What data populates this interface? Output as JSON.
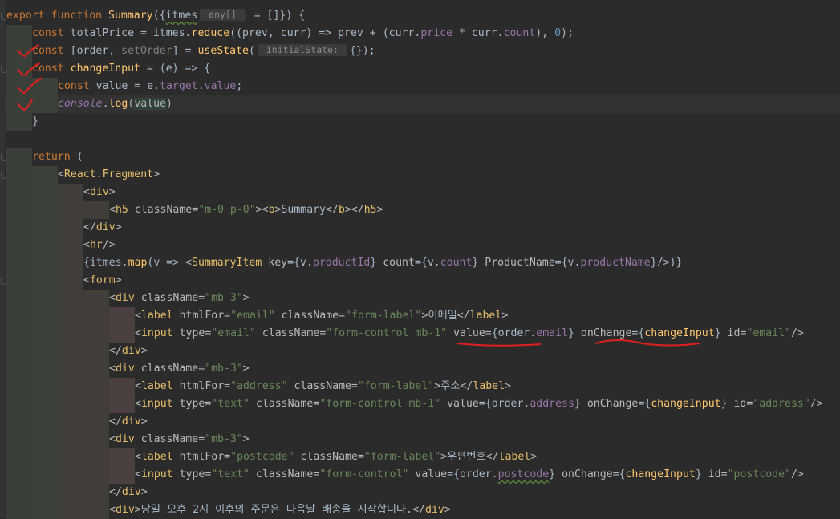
{
  "editor": {
    "lines": [
      [
        [
          "export function ",
          "kw"
        ],
        [
          "Summary",
          "fn"
        ],
        [
          "({",
          ""
        ],
        [
          "itmes",
          "u"
        ],
        [
          " any[] ",
          "hint"
        ],
        [
          " = []}) {",
          ""
        ]
      ],
      [
        [
          "const ",
          "kw"
        ],
        [
          "totalPrice = itmes.",
          ""
        ],
        [
          "reduce",
          "fn"
        ],
        [
          "((prev, curr) => prev + (curr.",
          ""
        ],
        [
          "price",
          "pr"
        ],
        [
          " * curr.",
          ""
        ],
        [
          "count",
          "pr"
        ],
        [
          "), ",
          ""
        ],
        [
          "0",
          "num"
        ],
        [
          ");",
          ""
        ]
      ],
      [
        [
          "const ",
          "kw"
        ],
        [
          "[order, ",
          ""
        ],
        [
          "setOrder",
          "gray"
        ],
        [
          "] = ",
          ""
        ],
        [
          "useState",
          "fn"
        ],
        [
          "(",
          ""
        ],
        [
          " initialState: ",
          "hint"
        ],
        [
          "{});",
          ""
        ]
      ],
      [
        [
          "const ",
          "kw"
        ],
        [
          "changeInput",
          "fn"
        ],
        [
          " = (e) => {",
          ""
        ]
      ],
      [
        [
          "const ",
          "kw"
        ],
        [
          "value = e.",
          ""
        ],
        [
          "target",
          "pr"
        ],
        [
          ".",
          ""
        ],
        [
          "value",
          "pr"
        ],
        [
          ";",
          ""
        ]
      ],
      [
        [
          "console",
          "pr it"
        ],
        [
          ".",
          ""
        ],
        [
          "log",
          "fn"
        ],
        [
          "(",
          ""
        ],
        [
          "value",
          "hl"
        ],
        [
          ")",
          ""
        ]
      ],
      [
        [
          "}",
          ""
        ]
      ],
      [
        [
          "",
          ""
        ]
      ],
      [
        [
          "return ",
          "kw"
        ],
        [
          "(",
          ""
        ]
      ],
      [
        [
          "<",
          "at"
        ],
        [
          "React.Fragment",
          "tg"
        ],
        [
          ">",
          "at"
        ]
      ],
      [
        [
          "<",
          "at"
        ],
        [
          "div",
          "tg"
        ],
        [
          ">",
          "at"
        ]
      ],
      [
        [
          "<",
          "at"
        ],
        [
          "h5 ",
          "tg"
        ],
        [
          "className",
          "at"
        ],
        [
          "=",
          "at"
        ],
        [
          "\"m-0 p-0\"",
          "st"
        ],
        [
          "><",
          "at"
        ],
        [
          "b",
          "tg"
        ],
        [
          ">",
          "at"
        ],
        [
          "Summary",
          ""
        ],
        [
          "</",
          "at"
        ],
        [
          "b",
          "tg"
        ],
        [
          "></",
          "at"
        ],
        [
          "h5",
          "tg"
        ],
        [
          ">",
          "at"
        ]
      ],
      [
        [
          "</",
          "at"
        ],
        [
          "div",
          "tg"
        ],
        [
          ">",
          "at"
        ]
      ],
      [
        [
          "<",
          "at"
        ],
        [
          "hr",
          "tg"
        ],
        [
          "/>",
          "at"
        ]
      ],
      [
        [
          "{itmes.",
          ""
        ],
        [
          "map",
          "fn"
        ],
        [
          "(v => ",
          ""
        ],
        [
          "<",
          "at"
        ],
        [
          "SummaryItem ",
          "tg"
        ],
        [
          "key",
          "at"
        ],
        [
          "={v.",
          ""
        ],
        [
          "productId",
          "pr"
        ],
        [
          "} ",
          ""
        ],
        [
          "count",
          "at"
        ],
        [
          "={v.",
          ""
        ],
        [
          "count",
          "pr"
        ],
        [
          "} ",
          ""
        ],
        [
          "ProductName",
          "at"
        ],
        [
          "={v.",
          ""
        ],
        [
          "productName",
          "pr"
        ],
        [
          "}/>)}",
          ""
        ]
      ],
      [
        [
          "<",
          "at"
        ],
        [
          "form",
          "tg"
        ],
        [
          ">",
          "at"
        ]
      ],
      [
        [
          "<",
          "at"
        ],
        [
          "div ",
          "tg"
        ],
        [
          "className",
          "at"
        ],
        [
          "=",
          "at"
        ],
        [
          "\"mb-3\"",
          "st"
        ],
        [
          ">",
          "at"
        ]
      ],
      [
        [
          "<",
          "at"
        ],
        [
          "label ",
          "tg"
        ],
        [
          "htmlFor",
          "at"
        ],
        [
          "=",
          "at"
        ],
        [
          "\"email\" ",
          "st"
        ],
        [
          "className",
          "at"
        ],
        [
          "=",
          "at"
        ],
        [
          "\"form-label\"",
          "st"
        ],
        [
          ">",
          "at"
        ],
        [
          "이메일",
          ""
        ],
        [
          "</",
          "at"
        ],
        [
          "label",
          "tg"
        ],
        [
          ">",
          "at"
        ]
      ],
      [
        [
          "<",
          "at"
        ],
        [
          "input ",
          "tg"
        ],
        [
          "type",
          "at"
        ],
        [
          "=",
          "at"
        ],
        [
          "\"email\" ",
          "st"
        ],
        [
          "className",
          "at"
        ],
        [
          "=",
          "at"
        ],
        [
          "\"form-control mb-1\" ",
          "st"
        ],
        [
          "value",
          "at"
        ],
        [
          "={order.",
          ""
        ],
        [
          "email",
          "pr"
        ],
        [
          "} ",
          ""
        ],
        [
          "onChange",
          "at"
        ],
        [
          "={",
          ""
        ],
        [
          "changeInput",
          "fn"
        ],
        [
          "} ",
          ""
        ],
        [
          "id",
          "at"
        ],
        [
          "=",
          "at"
        ],
        [
          "\"email\"",
          "st"
        ],
        [
          "/>",
          "at"
        ]
      ],
      [
        [
          "</",
          "at"
        ],
        [
          "div",
          "tg"
        ],
        [
          ">",
          "at"
        ]
      ],
      [
        [
          "<",
          "at"
        ],
        [
          "div ",
          "tg"
        ],
        [
          "className",
          "at"
        ],
        [
          "=",
          "at"
        ],
        [
          "\"mb-3\"",
          "st"
        ],
        [
          ">",
          "at"
        ]
      ],
      [
        [
          "<",
          "at"
        ],
        [
          "label ",
          "tg"
        ],
        [
          "htmlFor",
          "at"
        ],
        [
          "=",
          "at"
        ],
        [
          "\"address\" ",
          "st"
        ],
        [
          "className",
          "at"
        ],
        [
          "=",
          "at"
        ],
        [
          "\"form-label\"",
          "st"
        ],
        [
          ">",
          "at"
        ],
        [
          "주소",
          ""
        ],
        [
          "</",
          "at"
        ],
        [
          "label",
          "tg"
        ],
        [
          ">",
          "at"
        ]
      ],
      [
        [
          "<",
          "at"
        ],
        [
          "input ",
          "tg"
        ],
        [
          "type",
          "at"
        ],
        [
          "=",
          "at"
        ],
        [
          "\"text\" ",
          "st"
        ],
        [
          "className",
          "at"
        ],
        [
          "=",
          "at"
        ],
        [
          "\"form-control mb-1\" ",
          "st"
        ],
        [
          "value",
          "at"
        ],
        [
          "={order.",
          ""
        ],
        [
          "address",
          "pr"
        ],
        [
          "} ",
          ""
        ],
        [
          "onChange",
          "at"
        ],
        [
          "={",
          ""
        ],
        [
          "changeInput",
          "fn"
        ],
        [
          "} ",
          ""
        ],
        [
          "id",
          "at"
        ],
        [
          "=",
          "at"
        ],
        [
          "\"address\"",
          "st"
        ],
        [
          "/>",
          "at"
        ]
      ],
      [
        [
          "</",
          "at"
        ],
        [
          "div",
          "tg"
        ],
        [
          ">",
          "at"
        ]
      ],
      [
        [
          "<",
          "at"
        ],
        [
          "div ",
          "tg"
        ],
        [
          "className",
          "at"
        ],
        [
          "=",
          "at"
        ],
        [
          "\"mb-3\"",
          "st"
        ],
        [
          ">",
          "at"
        ]
      ],
      [
        [
          "<",
          "at"
        ],
        [
          "label ",
          "tg"
        ],
        [
          "htmlFor",
          "at"
        ],
        [
          "=",
          "at"
        ],
        [
          "\"postcode\" ",
          "st"
        ],
        [
          "className",
          "at"
        ],
        [
          "=",
          "at"
        ],
        [
          "\"form-label\"",
          "st"
        ],
        [
          ">",
          "at"
        ],
        [
          "우편번호",
          ""
        ],
        [
          "</",
          "at"
        ],
        [
          "label",
          "tg"
        ],
        [
          ">",
          "at"
        ]
      ],
      [
        [
          "<",
          "at"
        ],
        [
          "input ",
          "tg"
        ],
        [
          "type",
          "at"
        ],
        [
          "=",
          "at"
        ],
        [
          "\"text\" ",
          "st"
        ],
        [
          "className",
          "at"
        ],
        [
          "=",
          "at"
        ],
        [
          "\"form-control\" ",
          "st"
        ],
        [
          "value",
          "at"
        ],
        [
          "={order.",
          ""
        ],
        [
          "postcode",
          "pr u"
        ],
        [
          "} ",
          ""
        ],
        [
          "onChange",
          "at"
        ],
        [
          "={",
          ""
        ],
        [
          "changeInput",
          "fn"
        ],
        [
          "} ",
          ""
        ],
        [
          "id",
          "at"
        ],
        [
          "=",
          "at"
        ],
        [
          "\"postcode\"",
          "st"
        ],
        [
          "/>",
          "at"
        ]
      ],
      [
        [
          "</",
          "at"
        ],
        [
          "div",
          "tg"
        ],
        [
          ">",
          "at"
        ]
      ],
      [
        [
          "<",
          "at"
        ],
        [
          "div",
          "tg"
        ],
        [
          ">",
          "at"
        ],
        [
          "당일 오후 2시 이후의 주문은 다음날 배송을 시작합니다.",
          ""
        ],
        [
          "</",
          "at"
        ],
        [
          "div",
          "tg"
        ],
        [
          ">",
          "at"
        ]
      ]
    ]
  }
}
